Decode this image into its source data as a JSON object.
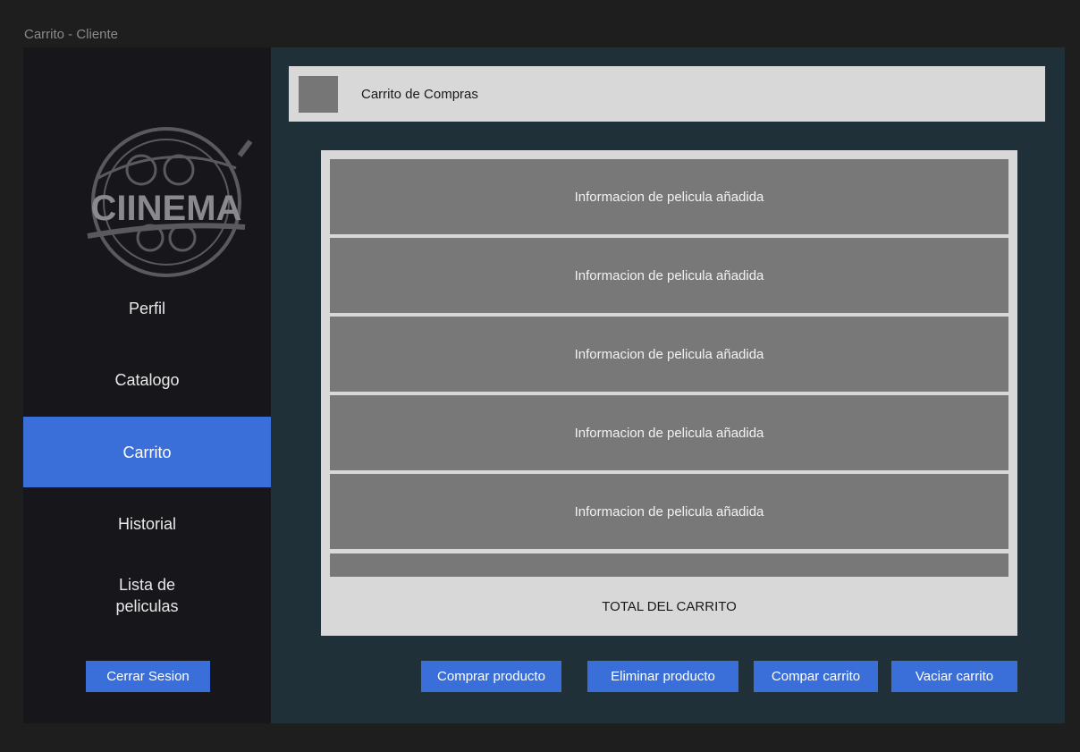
{
  "window": {
    "title": "Carrito - Cliente"
  },
  "colors": {
    "accent": "#3a6fd9",
    "sidebar_bg": "#17171b",
    "main_bg": "#1f3038",
    "panel_bg": "#d8d8d8",
    "item_bg": "#787878"
  },
  "sidebar": {
    "logo_text": "CIINEMA",
    "nav": [
      {
        "label": "Perfil",
        "active": false
      },
      {
        "label": "Catalogo",
        "active": false
      },
      {
        "label": "Carrito",
        "active": true
      },
      {
        "label": "Historial",
        "active": false
      },
      {
        "label": "Lista de peliculas",
        "active": false
      }
    ],
    "logout_label": "Cerrar Sesion"
  },
  "header": {
    "title": "Carrito de Compras"
  },
  "cart": {
    "items": [
      {
        "label": "Informacion de pelicula añadida"
      },
      {
        "label": "Informacion de pelicula añadida"
      },
      {
        "label": "Informacion de pelicula añadida"
      },
      {
        "label": "Informacion de pelicula añadida"
      },
      {
        "label": "Informacion de pelicula añadida"
      }
    ],
    "total_label": "TOTAL DEL CARRITO"
  },
  "actions": {
    "buy_product": "Comprar producto",
    "remove_product": "Eliminar producto",
    "buy_cart": "Compar carrito",
    "empty_cart": "Vaciar carrito"
  }
}
